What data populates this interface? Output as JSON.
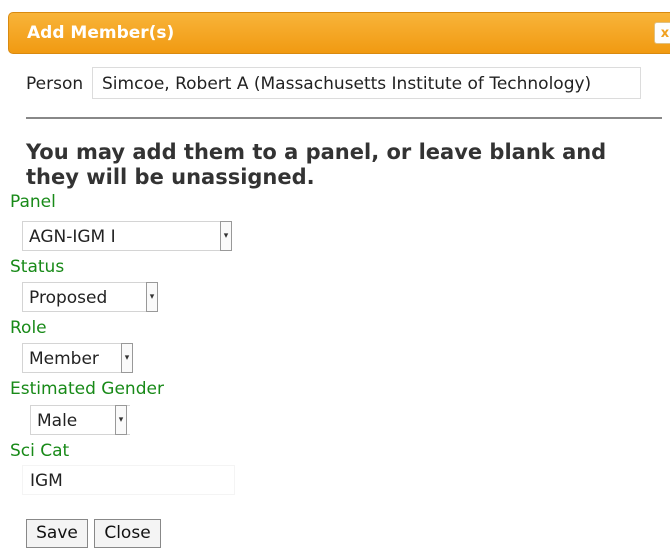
{
  "dialog": {
    "title": "Add Member(s)",
    "close_label": "x"
  },
  "person": {
    "label": "Person",
    "value": "Simcoe, Robert A (Massachusetts Institute of Technology)"
  },
  "instruction": "You may add them to a panel, or leave blank and they will be unassigned.",
  "fields": {
    "panel": {
      "label": "Panel",
      "value": "AGN-IGM I"
    },
    "status": {
      "label": "Status",
      "value": "Proposed"
    },
    "role": {
      "label": "Role",
      "value": "Member"
    },
    "gender": {
      "label": "Estimated Gender",
      "value": "Male"
    },
    "scicat": {
      "label": "Sci Cat",
      "value": "IGM"
    }
  },
  "buttons": {
    "save": "Save",
    "close": "Close"
  },
  "colors": {
    "titlebar": "#f19a12",
    "field_label": "#188a18"
  }
}
